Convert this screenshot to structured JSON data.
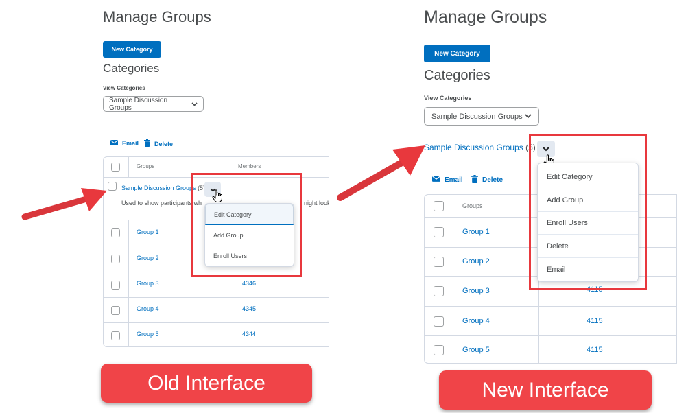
{
  "old": {
    "title": "Manage Groups",
    "new_category_label": "New Category",
    "categories_heading": "Categories",
    "view_categories_label": "View Categories",
    "select_value": "Sample Discussion Groups",
    "email_label": "Email",
    "delete_label": "Delete",
    "col_groups": "Groups",
    "col_members": "Members",
    "category_link": "Sample Discussion Groups",
    "category_count": "(5)",
    "description": "Used to show participants wh",
    "description_tail": "night look lik",
    "rows": [
      {
        "group": "Group 1",
        "members": ""
      },
      {
        "group": "Group 2",
        "members": ""
      },
      {
        "group": "Group 3",
        "members": "4346"
      },
      {
        "group": "Group 4",
        "members": "4345"
      },
      {
        "group": "Group 5",
        "members": "4344"
      }
    ],
    "menu": [
      "Edit Category",
      "Add Group",
      "Enroll Users"
    ],
    "caption": "Old Interface"
  },
  "new": {
    "title": "Manage Groups",
    "new_category_label": "New Category",
    "categories_heading": "Categories",
    "view_categories_label": "View Categories",
    "select_value": "Sample Discussion Groups",
    "category_link": "Sample Discussion Groups",
    "category_count": "(5)",
    "email_label": "Email",
    "delete_label": "Delete",
    "col_groups": "Groups",
    "rows": [
      {
        "group": "Group 1",
        "members": ""
      },
      {
        "group": "Group 2",
        "members": ""
      },
      {
        "group": "Group 3",
        "members": "4115"
      },
      {
        "group": "Group 4",
        "members": "4115"
      },
      {
        "group": "Group 5",
        "members": "4115"
      }
    ],
    "menu": [
      "Edit Category",
      "Add Group",
      "Enroll Users",
      "Delete",
      "Email"
    ],
    "caption": "New Interface"
  },
  "colors": {
    "brand_blue": "#006fbf",
    "arrow_red": "#e8383d",
    "caption_red": "#f04448",
    "text_gray": "#494c4e"
  },
  "icons": [
    "chevron-down-icon",
    "envelope-icon",
    "trash-icon",
    "hand-cursor-icon",
    "arrow-icon"
  ]
}
